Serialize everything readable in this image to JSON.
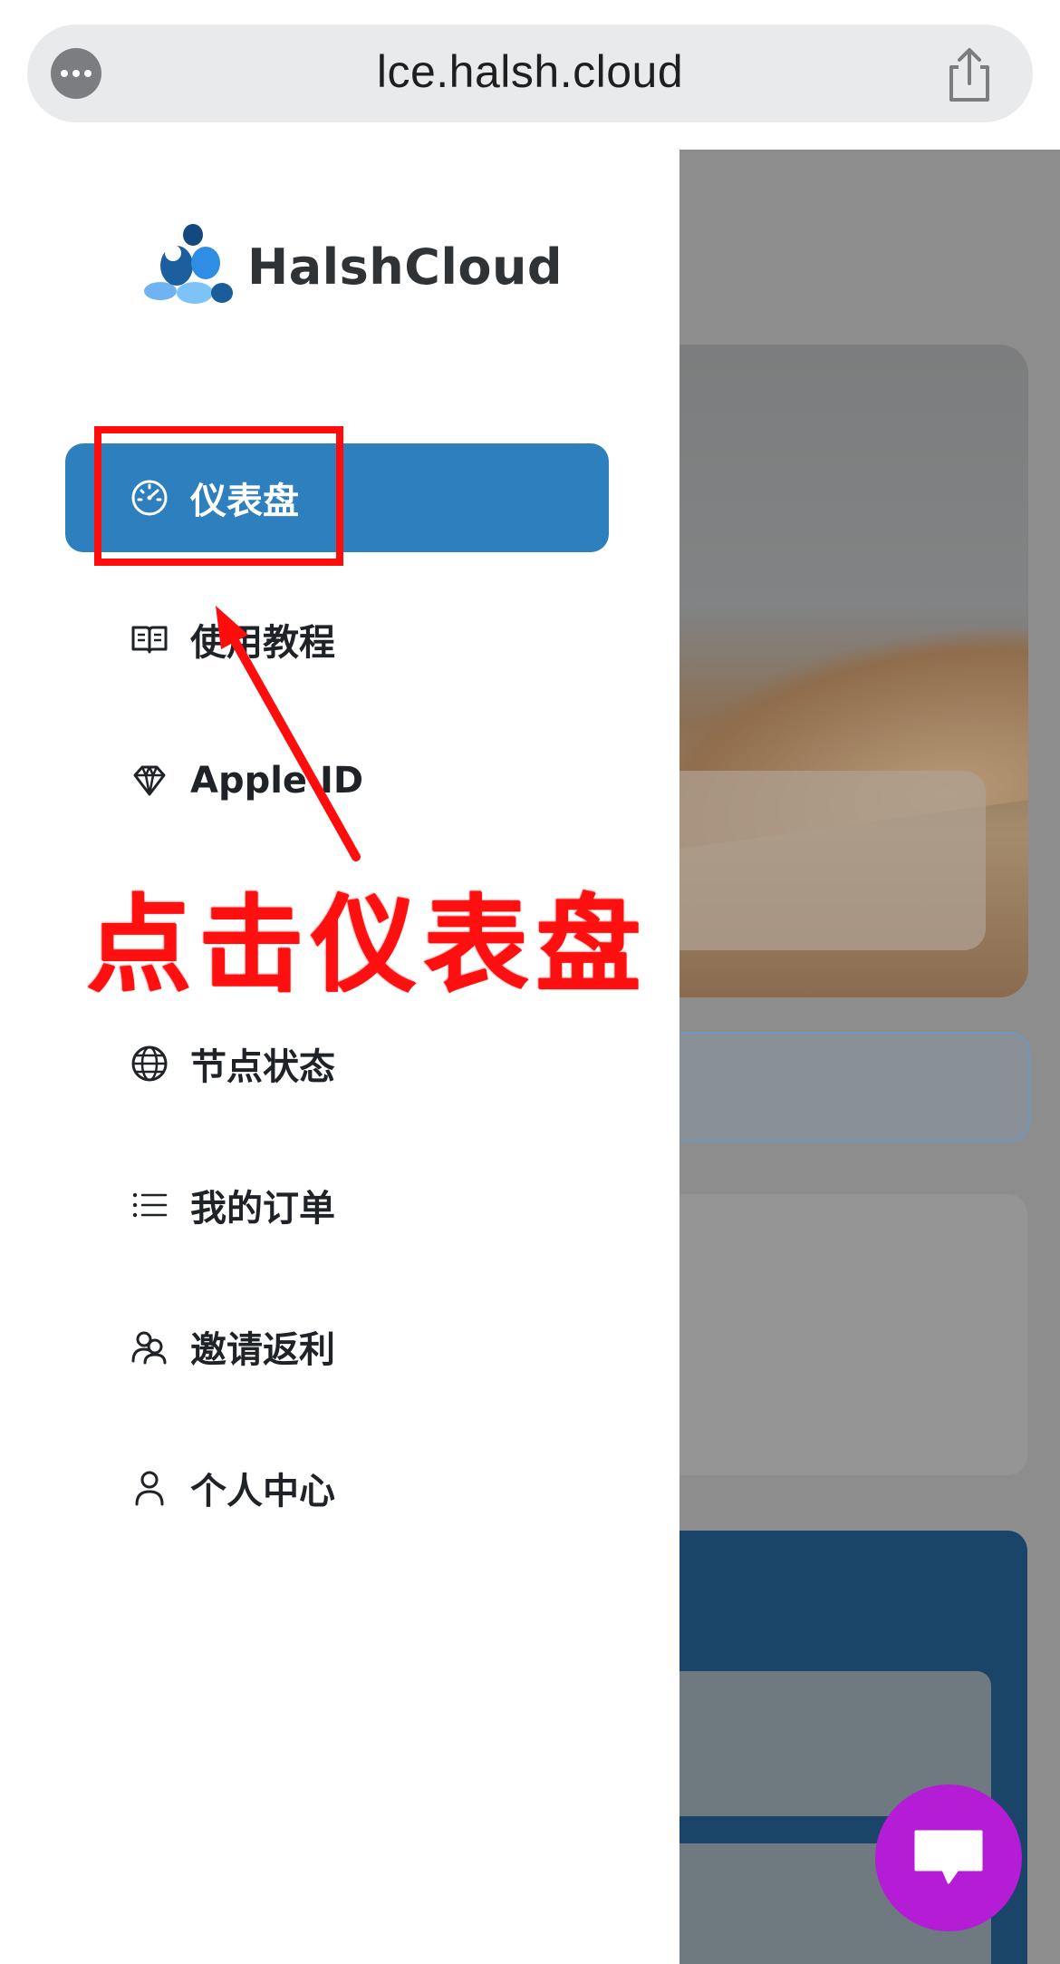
{
  "browser": {
    "url": "lce.halsh.cloud"
  },
  "logo": {
    "name": "HalshCloud"
  },
  "sidebar": {
    "items": [
      {
        "label": "仪表盘",
        "icon": "dashboard-gauge-icon",
        "active": true
      },
      {
        "label": "使用教程",
        "icon": "book-icon",
        "active": false
      },
      {
        "label": "Apple ID",
        "icon": "diamond-icon",
        "active": false
      },
      {
        "label": "",
        "icon": "",
        "active": false
      },
      {
        "label": "节点状态",
        "icon": "globe-icon",
        "active": false
      },
      {
        "label": "我的订单",
        "icon": "list-icon",
        "active": false
      },
      {
        "label": "邀请返利",
        "icon": "users-icon",
        "active": false
      },
      {
        "label": "个人中心",
        "icon": "user-icon",
        "active": false
      }
    ]
  },
  "annotation": {
    "text": "点击仪表盘",
    "color": "#ff0d0d"
  },
  "colors": {
    "active_item": "#2e7fbe",
    "chat_button": "#b41cd6"
  }
}
